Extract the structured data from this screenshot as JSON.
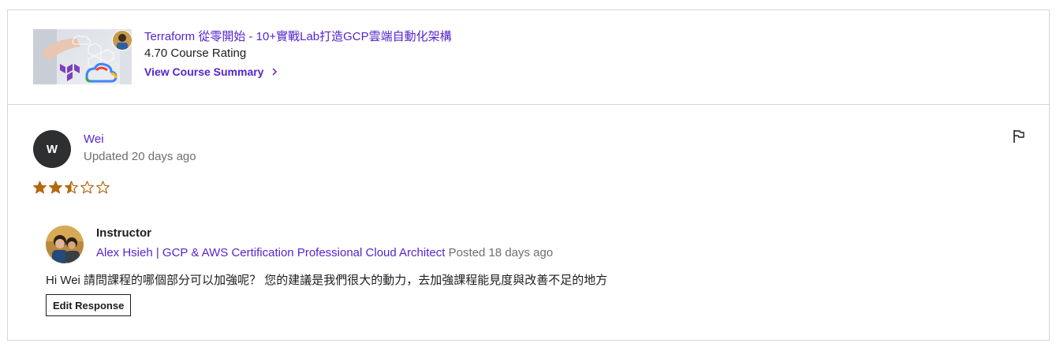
{
  "course": {
    "title": "Terraform 從零開始 - 10+實戰Lab打造GCP雲端自動化架構",
    "rating_text": "4.70 Course Rating",
    "summary_link": "View Course Summary",
    "thumbnail_icon": "course-thumbnail-terraform-gcp",
    "instructor_avatar_icon": "instructor-avatar"
  },
  "review": {
    "avatar_initial": "W",
    "reviewer_name": "Wei",
    "updated": "Updated 20 days ago",
    "rating": 2.5,
    "rating_max": 5,
    "star_color": "#b4690e",
    "flag_icon": "flag-icon"
  },
  "response": {
    "role": "Instructor",
    "instructor_name": "Alex Hsieh | GCP & AWS Certification Professional Cloud Architect",
    "posted": "Posted 18 days ago",
    "text": "Hi Wei 請問課程的哪個部分可以加強呢？ 您的建議是我們很大的動力，去加強課程能見度與改善不足的地方",
    "edit_button": "Edit Response"
  },
  "colors": {
    "link": "#5624d0",
    "muted": "#6a6f73",
    "border": "#d1d7dc",
    "star": "#b4690e"
  }
}
